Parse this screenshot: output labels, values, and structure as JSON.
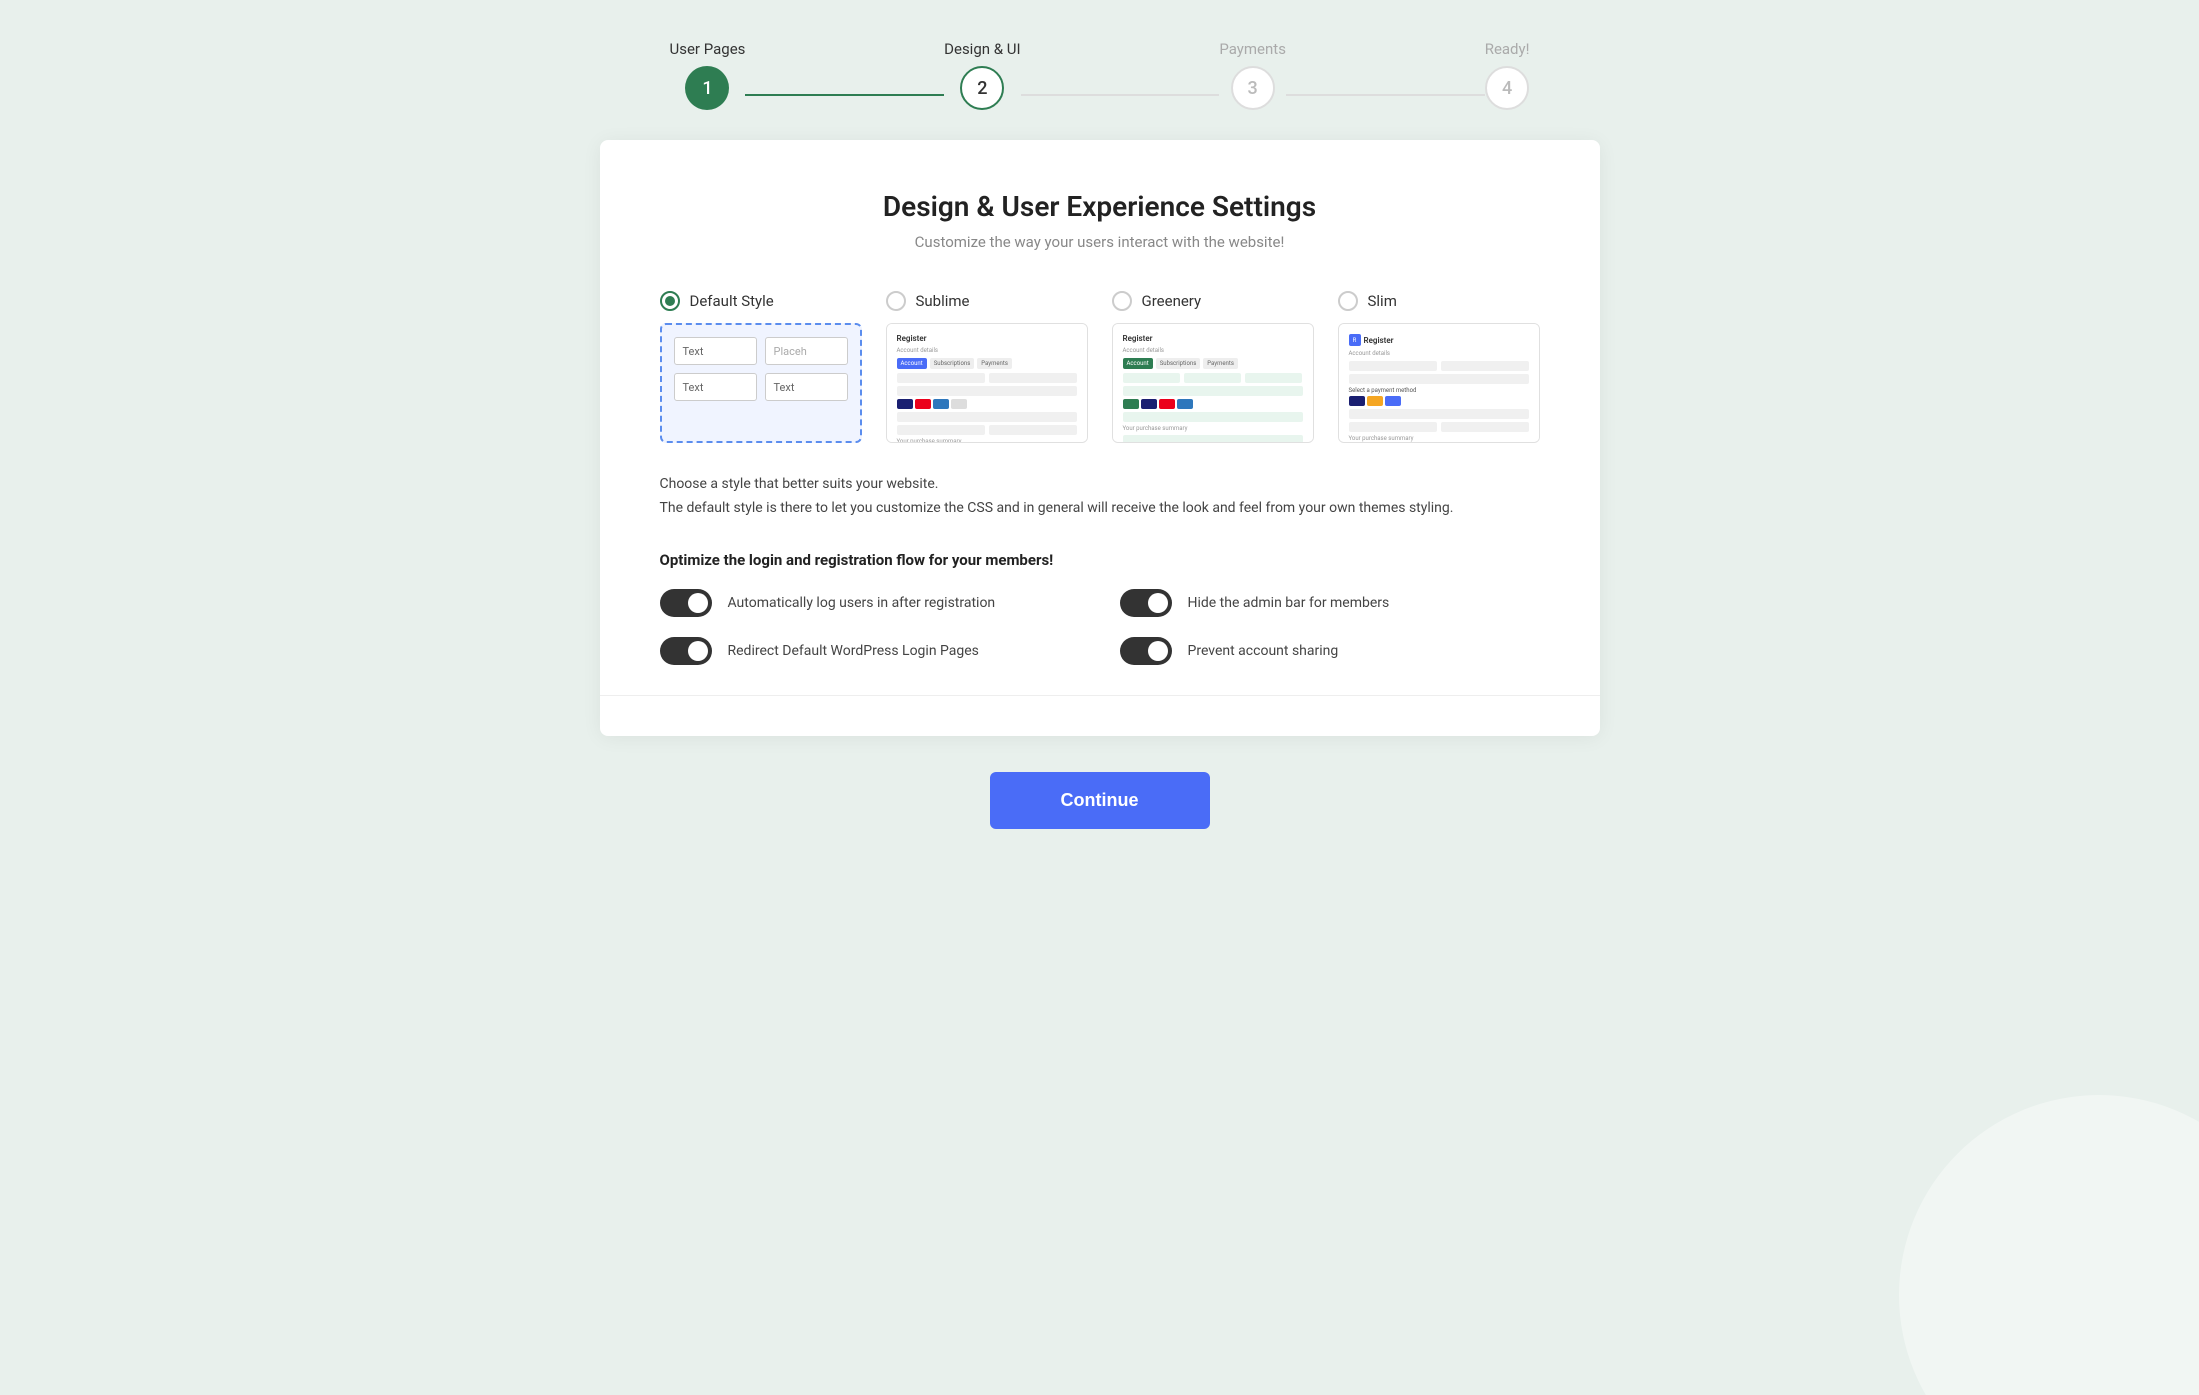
{
  "stepper": {
    "steps": [
      {
        "id": 1,
        "label": "User Pages",
        "state": "completed"
      },
      {
        "id": 2,
        "label": "Design & UI",
        "state": "active"
      },
      {
        "id": 3,
        "label": "Payments",
        "state": "inactive"
      },
      {
        "id": 4,
        "label": "Ready!",
        "state": "inactive"
      }
    ],
    "connectors": [
      "active",
      "inactive",
      "inactive"
    ]
  },
  "card": {
    "title": "Design & User Experience Settings",
    "subtitle": "Customize the way your users interact with the website!"
  },
  "style_options": [
    {
      "id": "default",
      "label": "Default Style",
      "selected": true
    },
    {
      "id": "sublime",
      "label": "Sublime",
      "selected": false
    },
    {
      "id": "greenery",
      "label": "Greenery",
      "selected": false
    },
    {
      "id": "slim",
      "label": "Slim",
      "selected": false
    }
  ],
  "description": {
    "line1": "Choose a style that better suits your website.",
    "line2": "The default style is there to let you customize the CSS and in general will receive the look and feel from your own themes styling."
  },
  "optimize_section": {
    "heading": "Optimize the login and registration flow for your members!"
  },
  "toggles": [
    {
      "id": "auto-login",
      "label": "Automatically log users in after registration",
      "on": true
    },
    {
      "id": "hide-admin",
      "label": "Hide the admin bar for members",
      "on": true
    },
    {
      "id": "redirect-login",
      "label": "Redirect Default WordPress Login Pages",
      "on": true
    },
    {
      "id": "prevent-sharing",
      "label": "Prevent account sharing",
      "on": true
    }
  ],
  "continue_button": {
    "label": "Continue"
  }
}
